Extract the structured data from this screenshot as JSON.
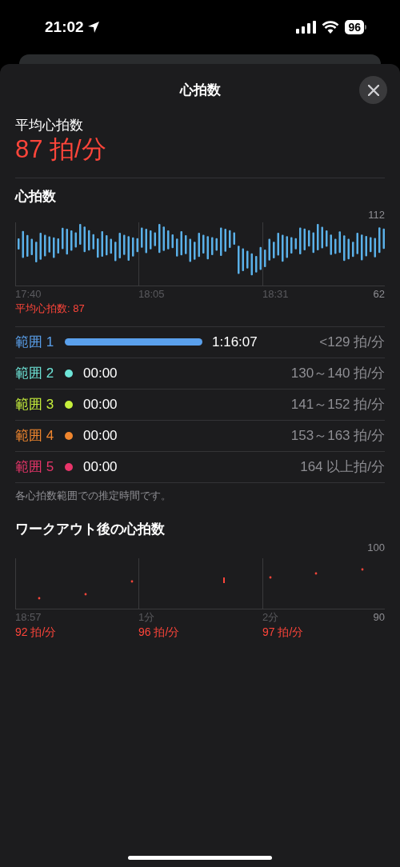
{
  "status_bar": {
    "time": "21:02",
    "battery": "96"
  },
  "sheet": {
    "title": "心拍数"
  },
  "summary": {
    "label": "平均心拍数",
    "value": "87 拍/分"
  },
  "heart_rate": {
    "title": "心拍数",
    "average": "平均心拍数: 87",
    "y_max": "112",
    "y_min": "62",
    "x_labels": [
      "17:40",
      "18:05",
      "18:31"
    ]
  },
  "zones": [
    {
      "name": "範囲 1",
      "color": "#5aa0ec",
      "kind": "bar",
      "time": "1:16:07",
      "range": "<129 拍/分"
    },
    {
      "name": "範囲 2",
      "color": "#6ee5d8",
      "kind": "dot",
      "time": "00:00",
      "range": "130～140 拍/分"
    },
    {
      "name": "範囲 3",
      "color": "#c6ef3c",
      "kind": "dot",
      "time": "00:00",
      "range": "141～152 拍/分"
    },
    {
      "name": "範囲 4",
      "color": "#f0862e",
      "kind": "dot",
      "time": "00:00",
      "range": "153～163 拍/分"
    },
    {
      "name": "範囲 5",
      "color": "#e8356a",
      "kind": "dot",
      "time": "00:00",
      "range": "164 以上拍/分"
    }
  ],
  "zones_note": "各心拍数範囲での推定時間です。",
  "recovery": {
    "title": "ワークアウト後の心拍数",
    "y_max": "100",
    "y_min": "90",
    "x_labels": [
      "18:57",
      "1分",
      "2分"
    ],
    "minute_values": [
      "92 拍/分",
      "96 拍/分",
      "97 拍/分"
    ]
  }
}
